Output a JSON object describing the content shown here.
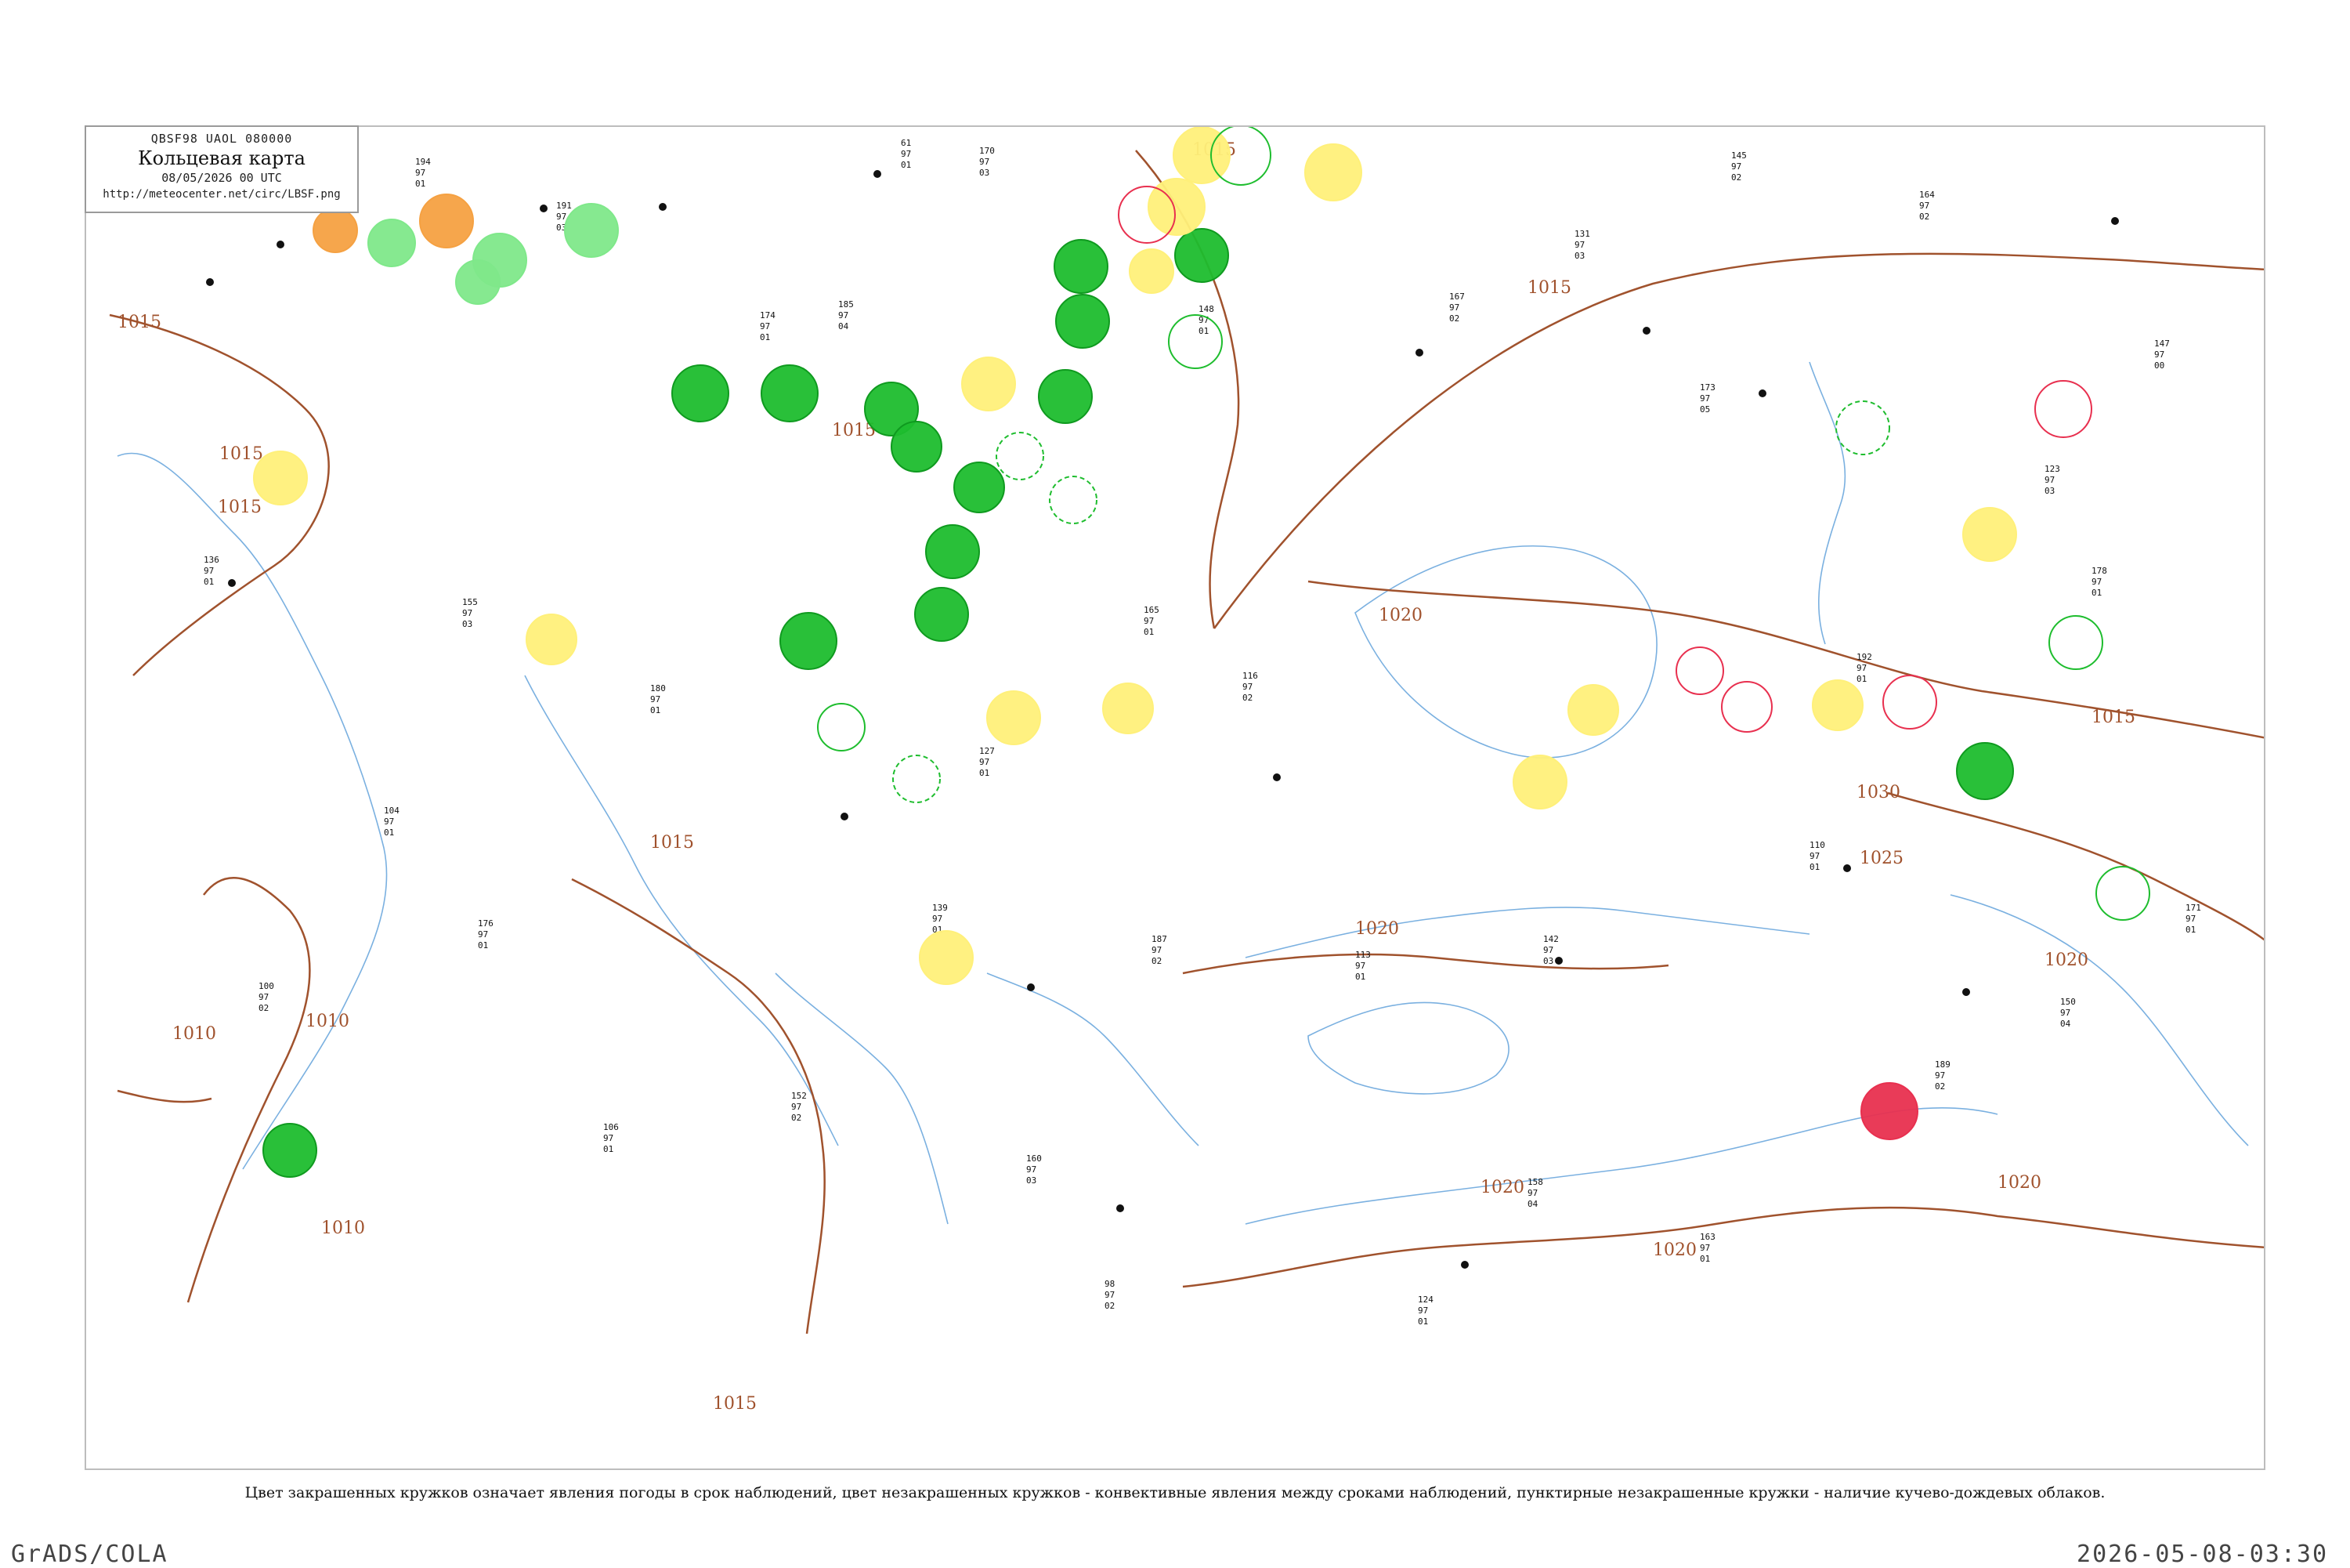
{
  "legend_box": {
    "code": "QBSF98  UAOL  080000",
    "title": "Кольцевая карта",
    "time": "08/05/2026 00 UTC",
    "url": "http://meteocenter.net/circ/LBSF.png"
  },
  "footer_note": "Цвет закрашенных кружков означает явления погоды в срок наблюдений, цвет незакрашенных кружков - конвективные явления между сроками наблюдений, пунктирные незакрашенные кружки - наличие кучево-дождевых облаков.",
  "bottom_left_label": "GrADS/COLA",
  "bottom_right_label": "2026-05-08-03:30",
  "colors": {
    "isobar": "#a0522d",
    "coastline": "#7ab0e0",
    "rain": "#1ebd2e",
    "shower": "#7fe88a",
    "fog_haze": "#fff07a",
    "thunder": "#e8304f",
    "dust": "#f5a142"
  },
  "isobars": [
    {
      "label": "1015"
    },
    {
      "label": "1015"
    },
    {
      "label": "1015"
    },
    {
      "label": "1015"
    },
    {
      "label": "1015"
    },
    {
      "label": "1015"
    },
    {
      "label": "1015"
    },
    {
      "label": "1015"
    },
    {
      "label": "1015"
    },
    {
      "label": "1010"
    },
    {
      "label": "1010"
    },
    {
      "label": "1010"
    },
    {
      "label": "1020"
    },
    {
      "label": "1020"
    },
    {
      "label": "1020"
    },
    {
      "label": "1020"
    },
    {
      "label": "1020"
    },
    {
      "label": "1030"
    },
    {
      "label": "1025"
    },
    {
      "label": "1020"
    }
  ],
  "weather_circles": [
    {
      "kind": "dust"
    },
    {
      "kind": "dust"
    },
    {
      "kind": "shower"
    },
    {
      "kind": "shower"
    },
    {
      "kind": "shower"
    },
    {
      "kind": "shower"
    },
    {
      "kind": "rain"
    },
    {
      "kind": "rain"
    },
    {
      "kind": "rain"
    },
    {
      "kind": "rain"
    },
    {
      "kind": "rain"
    },
    {
      "kind": "rain"
    },
    {
      "kind": "rain"
    },
    {
      "kind": "rain"
    },
    {
      "kind": "rain"
    },
    {
      "kind": "rain"
    },
    {
      "kind": "rain"
    },
    {
      "kind": "rain"
    },
    {
      "kind": "rain"
    },
    {
      "kind": "rain"
    },
    {
      "kind": "fog_haze"
    },
    {
      "kind": "fog_haze"
    },
    {
      "kind": "fog_haze"
    },
    {
      "kind": "fog_haze"
    },
    {
      "kind": "fog_haze"
    },
    {
      "kind": "fog_haze"
    },
    {
      "kind": "fog_haze"
    },
    {
      "kind": "fog_haze"
    },
    {
      "kind": "fog_haze"
    },
    {
      "kind": "fog_haze"
    },
    {
      "kind": "fog_haze"
    },
    {
      "kind": "fog_haze"
    },
    {
      "kind": "fog_haze"
    },
    {
      "kind": "fog_haze"
    },
    {
      "kind": "thunder"
    }
  ],
  "stations": [
    {
      "a": "194",
      "b": "97",
      "c": "01"
    },
    {
      "a": "191",
      "b": "97",
      "c": "03"
    },
    {
      "a": "174",
      "b": "97",
      "c": "01"
    },
    {
      "a": "185",
      "b": "97",
      "c": "04"
    },
    {
      "a": "61",
      "b": "97",
      "c": "01"
    },
    {
      "a": "170",
      "b": "97",
      "c": "03"
    },
    {
      "a": "148",
      "b": "97",
      "c": "01"
    },
    {
      "a": "167",
      "b": "97",
      "c": "02"
    },
    {
      "a": "173",
      "b": "97",
      "c": "05"
    },
    {
      "a": "164",
      "b": "97",
      "c": "02"
    },
    {
      "a": "136",
      "b": "97",
      "c": "01"
    },
    {
      "a": "155",
      "b": "97",
      "c": "03"
    },
    {
      "a": "180",
      "b": "97",
      "c": "01"
    },
    {
      "a": "127",
      "b": "97",
      "c": "01"
    },
    {
      "a": "116",
      "b": "97",
      "c": "02"
    },
    {
      "a": "192",
      "b": "97",
      "c": "01"
    },
    {
      "a": "123",
      "b": "97",
      "c": "03"
    },
    {
      "a": "147",
      "b": "97",
      "c": "00"
    },
    {
      "a": "104",
      "b": "97",
      "c": "01"
    },
    {
      "a": "176",
      "b": "97",
      "c": "01"
    },
    {
      "a": "100",
      "b": "97",
      "c": "02"
    },
    {
      "a": "139",
      "b": "97",
      "c": "01"
    },
    {
      "a": "165",
      "b": "97",
      "c": "01"
    },
    {
      "a": "187",
      "b": "97",
      "c": "02"
    },
    {
      "a": "113",
      "b": "97",
      "c": "01"
    },
    {
      "a": "142",
      "b": "97",
      "c": "03"
    },
    {
      "a": "158",
      "b": "97",
      "c": "04"
    },
    {
      "a": "163",
      "b": "97",
      "c": "01"
    },
    {
      "a": "189",
      "b": "97",
      "c": "02"
    },
    {
      "a": "110",
      "b": "97",
      "c": "01"
    },
    {
      "a": "131",
      "b": "97",
      "c": "03"
    },
    {
      "a": "145",
      "b": "97",
      "c": "02"
    },
    {
      "a": "178",
      "b": "97",
      "c": "01"
    },
    {
      "a": "106",
      "b": "97",
      "c": "01"
    },
    {
      "a": "152",
      "b": "97",
      "c": "02"
    },
    {
      "a": "160",
      "b": "97",
      "c": "03"
    },
    {
      "a": "98",
      "b": "97",
      "c": "02"
    },
    {
      "a": "124",
      "b": "97",
      "c": "01"
    },
    {
      "a": "150",
      "b": "97",
      "c": "04"
    },
    {
      "a": "171",
      "b": "97",
      "c": "01"
    }
  ]
}
